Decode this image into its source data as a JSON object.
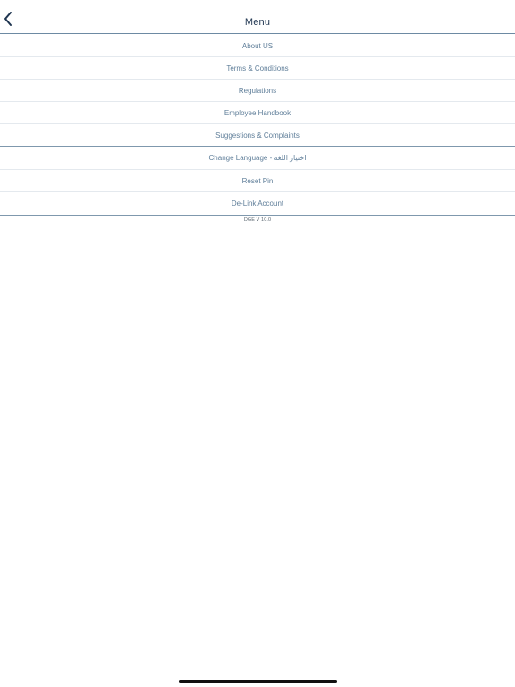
{
  "header": {
    "title": "Menu",
    "back_icon": "chevron-left-icon"
  },
  "menu": {
    "items": [
      {
        "label": "About US"
      },
      {
        "label": "Terms & Conditions"
      },
      {
        "label": "Regulations"
      },
      {
        "label": "Employee Handbook"
      },
      {
        "label": "Suggestions & Complaints"
      },
      {
        "label": "Change Language - اختيار اللغة"
      },
      {
        "label": "Reset Pin"
      },
      {
        "label": "De-Link Account"
      }
    ]
  },
  "footer": {
    "version": "DGE V 10.0"
  },
  "colors": {
    "accent": "#1f3550",
    "item_text": "#5f7e99",
    "divider": "#7f98ad"
  }
}
